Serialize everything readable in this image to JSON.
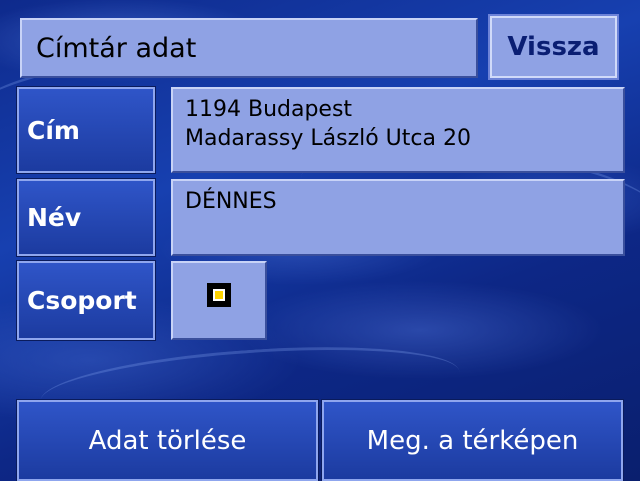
{
  "header": {
    "title": "Címtár adat",
    "back_label": "Vissza"
  },
  "fields": {
    "address_label": "Cím",
    "address_line1": "1194 Budapest",
    "address_line2": "Madarassy László Utca 20",
    "name_label": "Név",
    "name_value": "DÉNNES",
    "group_label": "Csoport",
    "group_color_outer": "#000000",
    "group_color_inner": "#ffd400"
  },
  "footer": {
    "delete_label": "Adat törlése",
    "show_map_label": "Meg. a térképen"
  }
}
